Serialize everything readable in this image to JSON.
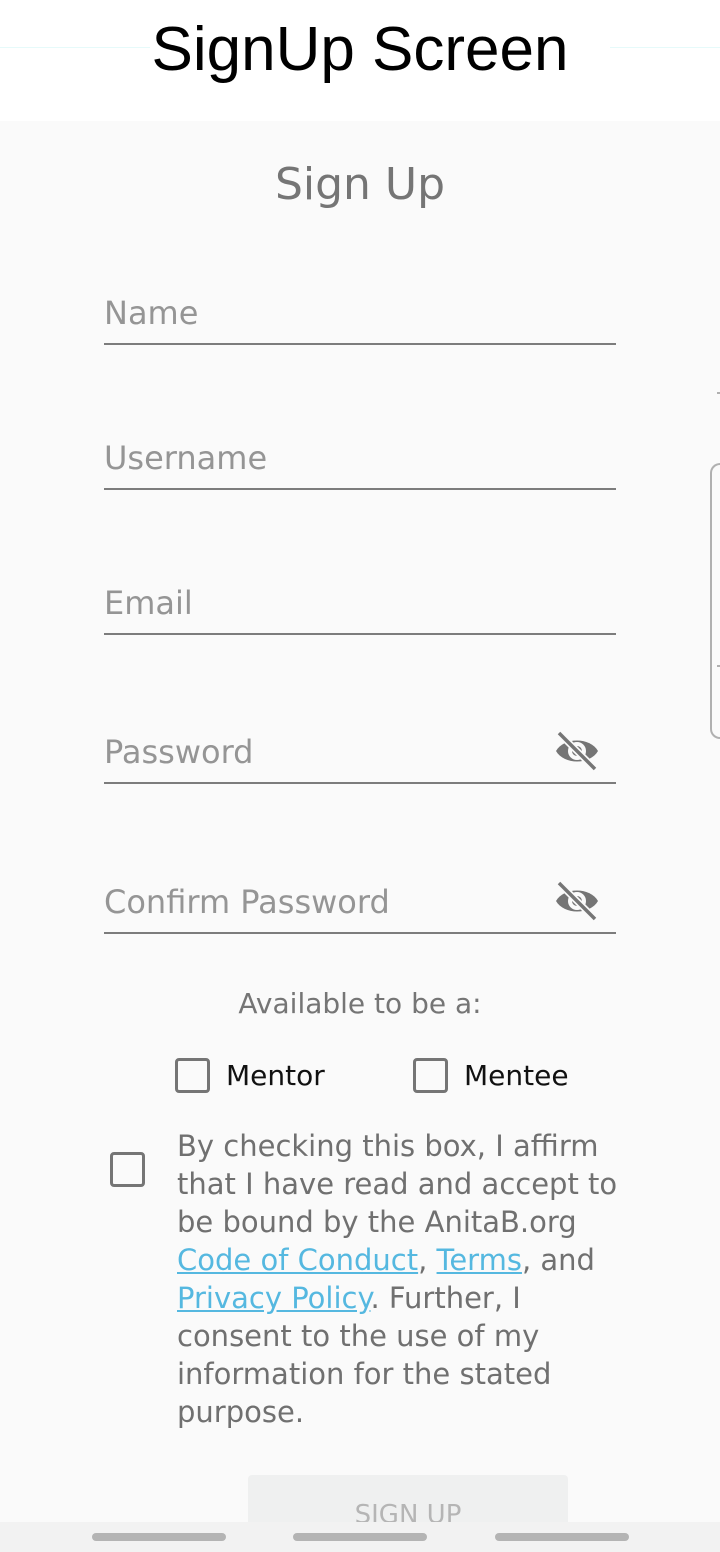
{
  "caption": {
    "title": "SignUp Screen"
  },
  "page": {
    "title": "Sign Up"
  },
  "form": {
    "fields": [
      {
        "name": "name",
        "placeholder": "Name",
        "value": ""
      },
      {
        "name": "username",
        "placeholder": "Username",
        "value": ""
      },
      {
        "name": "email",
        "placeholder": "Email",
        "value": ""
      },
      {
        "name": "password",
        "placeholder": "Password",
        "value": "",
        "icon": "visibility-off-icon"
      },
      {
        "name": "confirm_password",
        "placeholder": "Confirm Password",
        "value": "",
        "icon": "visibility-off-icon"
      }
    ],
    "availability": {
      "label": "Available to be a:",
      "options": [
        {
          "label": "Mentor",
          "checked": false
        },
        {
          "label": "Mentee",
          "checked": false
        }
      ]
    },
    "terms": {
      "checked": false,
      "text_before": "By checking this box, I affirm that I have read and accept to be bound by the AnitaB.org ",
      "link_code_of_conduct": "Code of Conduct",
      "sep1": ", ",
      "link_terms": "Terms",
      "sep2": ", and ",
      "link_privacy": "Privacy Policy",
      "text_after": ". Further, I consent to the use of my information for the stated purpose."
    },
    "submit_label": "SIGN UP"
  },
  "colors": {
    "link": "#55b8e0",
    "title": "#757575",
    "placeholder": "#959595",
    "button_disabled_bg": "#eff0f0",
    "button_disabled_text": "#b5b5b5"
  }
}
